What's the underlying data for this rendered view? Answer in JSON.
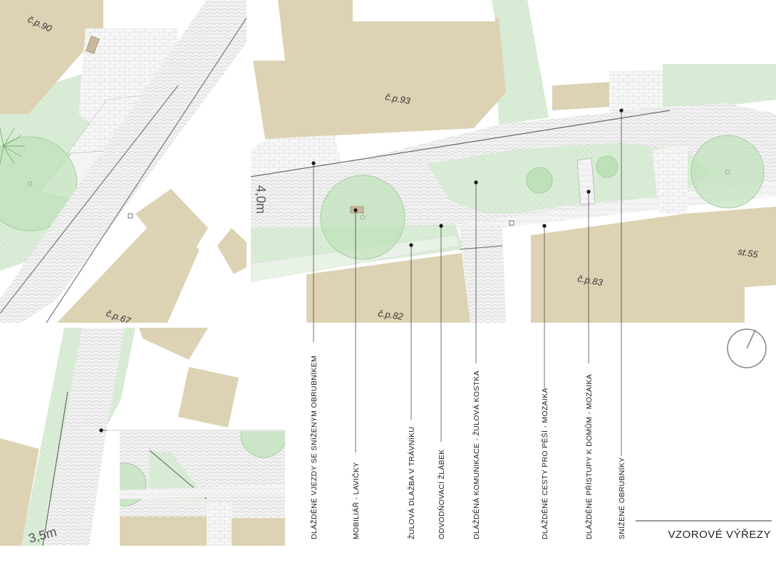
{
  "colors": {
    "building": "#ddd3b4",
    "grass": "#d8ebd6",
    "tree": "#b9ddb3",
    "tree_stroke": "#8fc08a",
    "paving": "#eeeeee",
    "paving_line": "#c8c8c8",
    "road": "#e9e9e9",
    "leader": "#333333"
  },
  "plots": {
    "cp90": "č.p.90",
    "cp93": "č.p.93",
    "cp67": "č.p.67",
    "cp82": "č.p.82",
    "cp83": "č.p.83",
    "st55": "st.55"
  },
  "dimensions": {
    "main_street_width": "4,0m",
    "side_street_width": "3,5m"
  },
  "legend": [
    {
      "id": "dlazdene-vjezdy",
      "label": "DLÁŽDĚNÉ VJEZDY SE SNÍŽENÝM OBRUBNÍKEM"
    },
    {
      "id": "mobiliar",
      "label": "MOBILIÁŘ - LAVIČKY"
    },
    {
      "id": "zulova-dlazba",
      "label": "ŽULOVÁ DLAŽBA V TRÁVNÍKU"
    },
    {
      "id": "odvodnovaci-zlabek",
      "label": "ODVODŇOVACÍ ŽLÁBEK"
    },
    {
      "id": "dlazdena-komunikace",
      "label": "DLÁŽDĚNÁ KOMUNIKACE - ŽULOVÁ KOSTKA"
    },
    {
      "id": "dlazdene-cesty",
      "label": "DLÁŽDĚNÉ CESTY PRO PĚŠÍ - MOZAIKA"
    },
    {
      "id": "dlazdene-pristupy",
      "label": "DLÁŽDĚNÉ PŘÍSTUPY K DOMŮM - MOZAIKA"
    },
    {
      "id": "snizene-obrubniky",
      "label": "SNÍŽENÉ OBRUBNÍKY"
    }
  ],
  "title": "VZOROVÉ VÝŘEZY",
  "icons": {
    "north_arrow": "north-arrow-icon"
  }
}
